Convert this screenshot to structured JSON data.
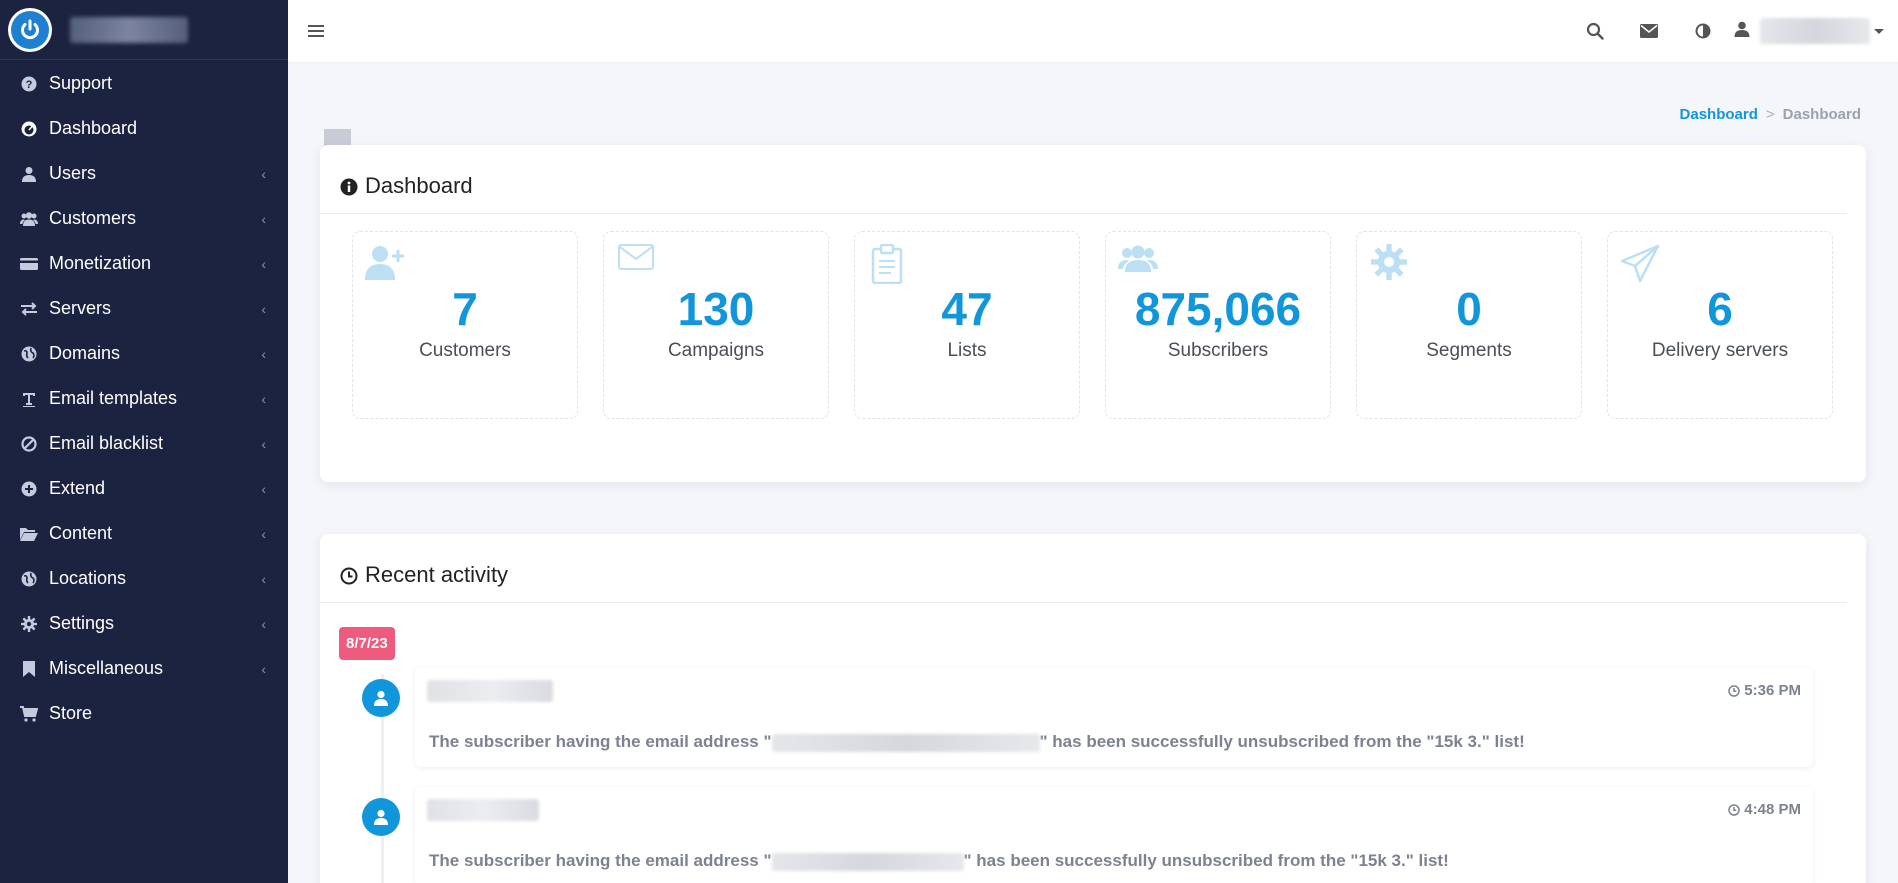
{
  "sidebar": {
    "items": [
      {
        "label": "Support",
        "icon": "question-circle-icon",
        "chevron": false
      },
      {
        "label": "Dashboard",
        "icon": "dashboard-gauge-icon",
        "chevron": false
      },
      {
        "label": "Users",
        "icon": "user-icon",
        "chevron": true
      },
      {
        "label": "Customers",
        "icon": "users-icon",
        "chevron": true
      },
      {
        "label": "Monetization",
        "icon": "credit-card-icon",
        "chevron": true
      },
      {
        "label": "Servers",
        "icon": "exchange-arrows-icon",
        "chevron": true
      },
      {
        "label": "Domains",
        "icon": "globe-icon",
        "chevron": true
      },
      {
        "label": "Email templates",
        "icon": "text-format-icon",
        "chevron": true
      },
      {
        "label": "Email blacklist",
        "icon": "ban-icon",
        "chevron": true
      },
      {
        "label": "Extend",
        "icon": "plus-circle-icon",
        "chevron": true
      },
      {
        "label": "Content",
        "icon": "folder-open-icon",
        "chevron": true
      },
      {
        "label": "Locations",
        "icon": "globe-icon",
        "chevron": true
      },
      {
        "label": "Settings",
        "icon": "gear-icon",
        "chevron": true
      },
      {
        "label": "Miscellaneous",
        "icon": "bookmark-icon",
        "chevron": true
      },
      {
        "label": "Store",
        "icon": "cart-icon",
        "chevron": false
      }
    ],
    "chevron_glyph": "‹"
  },
  "breadcrumb": {
    "link": "Dashboard",
    "separator": ">",
    "current": "Dashboard"
  },
  "dashboard": {
    "title": "Dashboard",
    "stats": [
      {
        "value": "7",
        "label": "Customers",
        "icon": "user-plus-icon"
      },
      {
        "value": "130",
        "label": "Campaigns",
        "icon": "envelope-icon"
      },
      {
        "value": "47",
        "label": "Lists",
        "icon": "clipboard-icon"
      },
      {
        "value": "875,066",
        "label": "Subscribers",
        "icon": "users-icon"
      },
      {
        "value": "0",
        "label": "Segments",
        "icon": "gear-icon"
      },
      {
        "value": "6",
        "label": "Delivery servers",
        "icon": "paper-plane-icon"
      }
    ]
  },
  "activity": {
    "title": "Recent activity",
    "date_badge": "8/7/23",
    "items": [
      {
        "time": "5:36 PM",
        "text_before": "The subscriber having the email address \"",
        "text_after": "\" has been successfully unsubscribed from the \"15k 3.\" list!"
      },
      {
        "time": "4:48 PM",
        "text_before": "The subscriber having the email address \"",
        "text_after": "\" has been successfully unsubscribed from the \"15k 3.\" list!"
      }
    ]
  },
  "colors": {
    "sidebar_bg": "#1b2340",
    "accent": "#1296db",
    "date_badge": "#ef5b7c"
  }
}
